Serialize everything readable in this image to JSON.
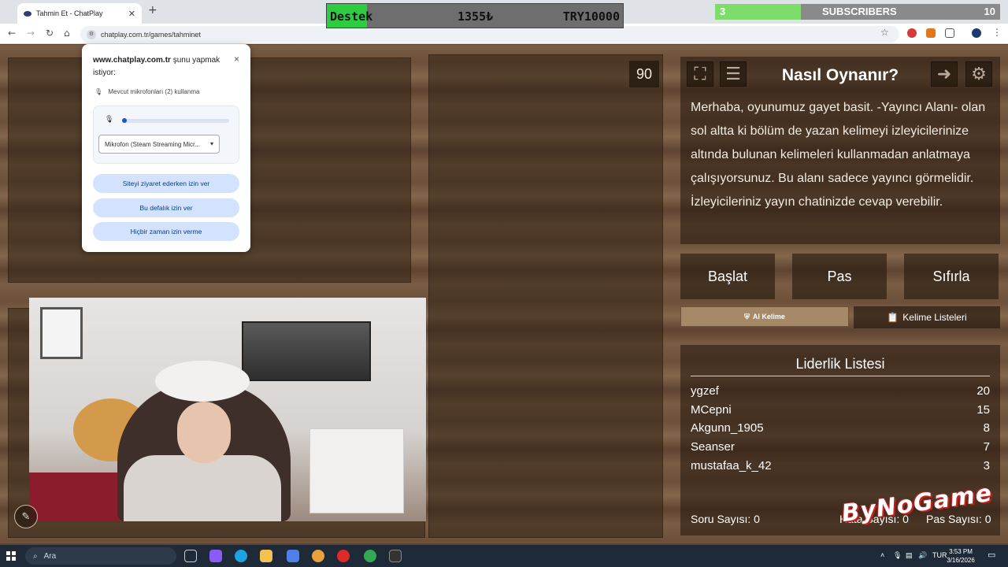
{
  "browser": {
    "tab_title": "Tahmin Et - ChatPlay",
    "new_tab": "+",
    "url": "chatplay.com.tr/games/tahminet"
  },
  "stream_overlay": {
    "donation": {
      "label": "Destek",
      "current": "1355₺",
      "goal": "TRY10000",
      "progress": 0.1355
    },
    "subs": {
      "current": "3",
      "label": "SUBSCRIBERS",
      "goal": "10",
      "progress": 0.3
    }
  },
  "permission_popup": {
    "site": "www.chatplay.com.tr",
    "title_suffix": "şunu yapmak istiyor:",
    "mic_label": "Mevcut mikrofonları (2) kullanma",
    "mic_select": "Mikrofon (Steam Streaming Micr...",
    "btn_allow_visit": "Siteyi ziyaret ederken izin ver",
    "btn_allow_once": "Bu defalık izin ver",
    "btn_never": "Hiçbir zaman izin verme",
    "close": "×"
  },
  "game": {
    "timer": "90",
    "how_to": {
      "title": "Nasıl Oynanır?",
      "text": "Merhaba, oyunumuz gayet basit. -Yayıncı Alanı- olan sol altta ki bölüm de yazan kelimeyi izleyicilerinize altında bulunan kelimeleri kullanmadan anlatmaya çalışıyorsunuz. Bu alanı sadece yayıncı görmelidir. İzleyicileriniz yayın chatinizde cevap verebilir."
    },
    "buttons": {
      "start": "Başlat",
      "pass": "Pas",
      "reset": "Sıfırla"
    },
    "ai_word": "AI Kelime",
    "word_lists": "Kelime Listeleri",
    "leaderboard": {
      "title": "Liderlik Listesi",
      "rows": [
        {
          "name": "ygzef",
          "score": "20"
        },
        {
          "name": "MCepni",
          "score": "15"
        },
        {
          "name": "Akgunn_1905",
          "score": "8"
        },
        {
          "name": "Seanser",
          "score": "7"
        },
        {
          "name": "mustafaa_k_42",
          "score": "3"
        }
      ],
      "question_count": "Soru Sayısı: 0",
      "error_count": "Hata Sayısı: 0",
      "pass_count": "Pas Sayısı: 0"
    }
  },
  "watermark": "ByNoGame",
  "taskbar": {
    "search": "Ara",
    "lang": "TUR",
    "time": "3:53 PM",
    "date": "3/16/2026"
  }
}
